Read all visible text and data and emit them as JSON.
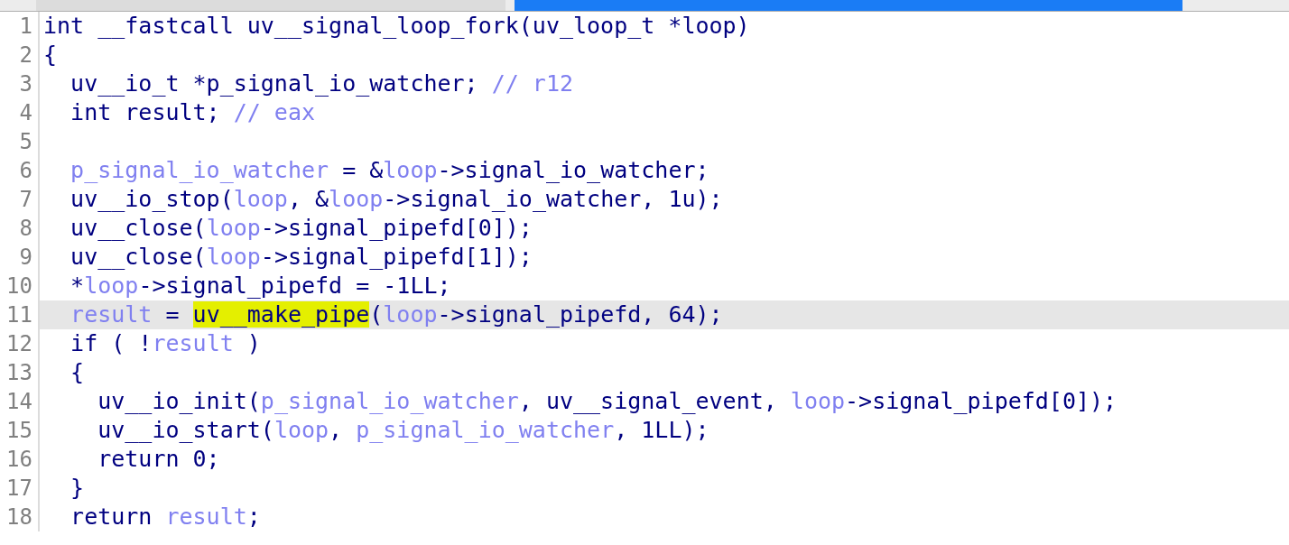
{
  "editor": {
    "lines": [
      {
        "number": "1",
        "current": false,
        "tokens": [
          {
            "kind": "code",
            "text": "int __fastcall uv__signal_loop_fork(uv_loop_t *loop)"
          }
        ]
      },
      {
        "number": "2",
        "current": false,
        "tokens": [
          {
            "kind": "code",
            "text": "{"
          }
        ]
      },
      {
        "number": "3",
        "current": false,
        "tokens": [
          {
            "kind": "code",
            "text": "  uv__io_t *p_signal_io_watcher; "
          },
          {
            "kind": "comment",
            "text": "// r12"
          }
        ]
      },
      {
        "number": "4",
        "current": false,
        "tokens": [
          {
            "kind": "code",
            "text": "  int result; "
          },
          {
            "kind": "comment",
            "text": "// eax"
          }
        ]
      },
      {
        "number": "5",
        "current": false
      },
      {
        "number": "6",
        "current": false,
        "tokens": [
          {
            "kind": "local",
            "text": "  p_signal_io_watcher"
          },
          {
            "kind": "code",
            "text": " = &"
          },
          {
            "kind": "local",
            "text": "loop"
          },
          {
            "kind": "code",
            "text": "->signal_io_watcher;"
          }
        ]
      },
      {
        "number": "7",
        "current": false,
        "tokens": [
          {
            "kind": "code",
            "text": "  uv__io_stop("
          },
          {
            "kind": "local",
            "text": "loop"
          },
          {
            "kind": "code",
            "text": ", &"
          },
          {
            "kind": "local",
            "text": "loop"
          },
          {
            "kind": "code",
            "text": "->signal_io_watcher, 1u);"
          }
        ]
      },
      {
        "number": "8",
        "current": false,
        "tokens": [
          {
            "kind": "code",
            "text": "  uv__close("
          },
          {
            "kind": "local",
            "text": "loop"
          },
          {
            "kind": "code",
            "text": "->signal_pipefd[0]);"
          }
        ]
      },
      {
        "number": "9",
        "current": false,
        "tokens": [
          {
            "kind": "code",
            "text": "  uv__close("
          },
          {
            "kind": "local",
            "text": "loop"
          },
          {
            "kind": "code",
            "text": "->signal_pipefd[1]);"
          }
        ]
      },
      {
        "number": "10",
        "current": false,
        "tokens": [
          {
            "kind": "code",
            "text": "  *"
          },
          {
            "kind": "local",
            "text": "loop"
          },
          {
            "kind": "code",
            "text": "->signal_pipefd = -1LL;"
          }
        ]
      },
      {
        "number": "11",
        "current": true,
        "tokens": [
          {
            "kind": "local",
            "text": "  result"
          },
          {
            "kind": "code",
            "text": " = "
          },
          {
            "kind": "highlight",
            "text": "uv__make_pipe"
          },
          {
            "kind": "code",
            "text": "("
          },
          {
            "kind": "local",
            "text": "loop"
          },
          {
            "kind": "code",
            "text": "->signal_pipefd, 64);"
          }
        ]
      },
      {
        "number": "12",
        "current": false,
        "tokens": [
          {
            "kind": "code",
            "text": "  if ( !"
          },
          {
            "kind": "local",
            "text": "result"
          },
          {
            "kind": "code",
            "text": " )"
          }
        ]
      },
      {
        "number": "13",
        "current": false,
        "tokens": [
          {
            "kind": "code",
            "text": "  {"
          }
        ]
      },
      {
        "number": "14",
        "current": false,
        "tokens": [
          {
            "kind": "code",
            "text": "    uv__io_init("
          },
          {
            "kind": "local",
            "text": "p_signal_io_watcher"
          },
          {
            "kind": "code",
            "text": ", uv__signal_event, "
          },
          {
            "kind": "local",
            "text": "loop"
          },
          {
            "kind": "code",
            "text": "->signal_pipefd[0]);"
          }
        ]
      },
      {
        "number": "15",
        "current": false,
        "tokens": [
          {
            "kind": "code",
            "text": "    uv__io_start("
          },
          {
            "kind": "local",
            "text": "loop"
          },
          {
            "kind": "code",
            "text": ", "
          },
          {
            "kind": "local",
            "text": "p_signal_io_watcher"
          },
          {
            "kind": "code",
            "text": ", 1LL);"
          }
        ]
      },
      {
        "number": "16",
        "current": false,
        "tokens": [
          {
            "kind": "code",
            "text": "    return 0;"
          }
        ]
      },
      {
        "number": "17",
        "current": false,
        "tokens": [
          {
            "kind": "code",
            "text": "  }"
          }
        ]
      },
      {
        "number": "18",
        "current": false,
        "tokens": [
          {
            "kind": "code",
            "text": "  return "
          },
          {
            "kind": "local",
            "text": "result"
          },
          {
            "kind": "code",
            "text": ";"
          }
        ]
      }
    ]
  }
}
